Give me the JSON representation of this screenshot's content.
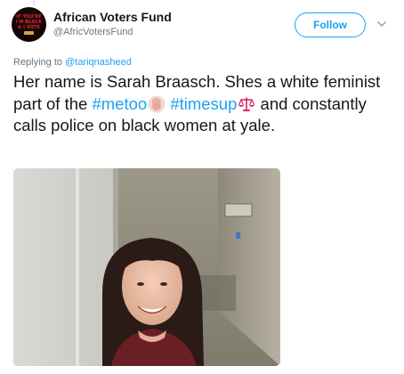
{
  "account": {
    "display_name": "African Voters Fund",
    "handle": "@AfricVotersFund",
    "avatar_text": [
      "IF YOU'RE",
      "I'M BLACK",
      "& I VOTE"
    ]
  },
  "follow_button": {
    "label": "Follow"
  },
  "reply_context": {
    "prefix": "Replying to ",
    "mention": "@tariqnasheed"
  },
  "tweet": {
    "text_part_1": "Her name is Sarah Braasch. Shes a white feminist part of the ",
    "hashtag_1": "#metoo",
    "text_part_2": " ",
    "hashtag_2": "#timesup",
    "text_part_3": " and constantly calls police on black women at yale."
  },
  "media": {
    "type": "photo"
  },
  "colors": {
    "accent": "#1da1f2",
    "text": "#14171a",
    "secondary_text": "#657786"
  },
  "icons": {
    "caret": "chevron-down-icon",
    "emoji_1": "raised-hand-emoji",
    "emoji_2": "scales-emoji"
  }
}
